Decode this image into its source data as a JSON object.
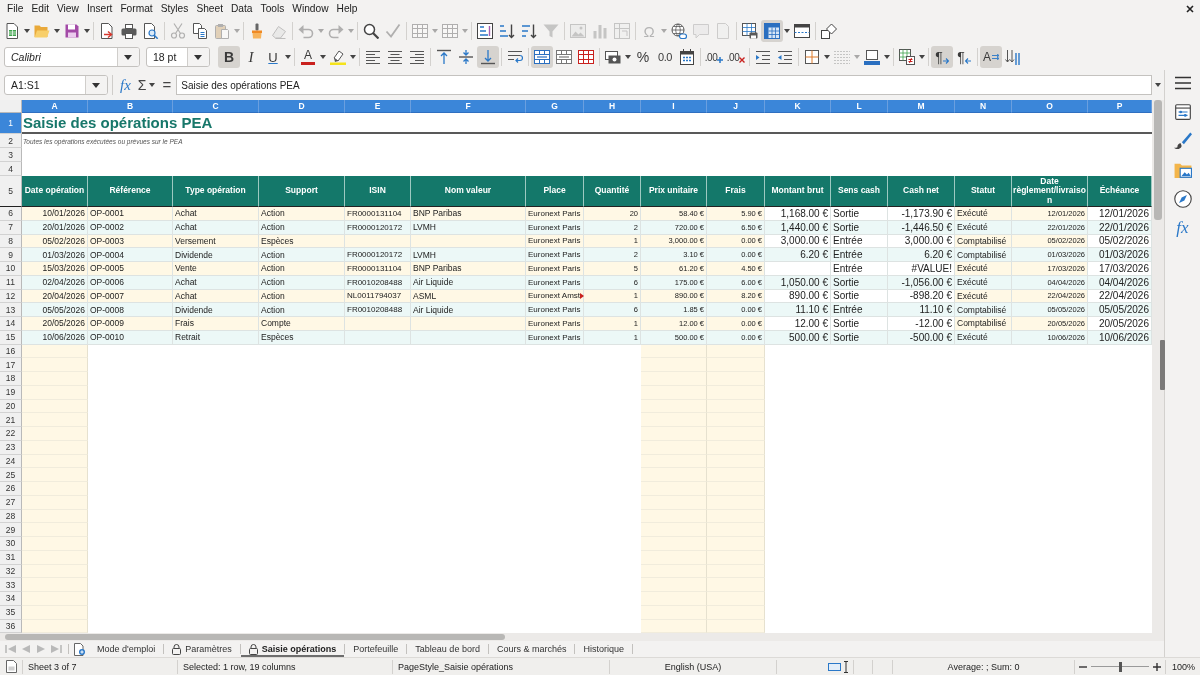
{
  "menu_bar": {
    "items": [
      "File",
      "Edit",
      "View",
      "Insert",
      "Format",
      "Styles",
      "Sheet",
      "Data",
      "Tools",
      "Window",
      "Help"
    ]
  },
  "standard_toolbar": {
    "groups": [
      [
        {
          "kind": "new",
          "on": false,
          "disabled": false
        },
        {
          "kind": "open",
          "on": false,
          "disabled": false
        },
        {
          "kind": "save",
          "on": false,
          "disabled": false
        }
      ],
      [
        {
          "kind": "pdf",
          "on": false,
          "disabled": false
        },
        {
          "kind": "print",
          "on": false,
          "disabled": false
        },
        {
          "kind": "preview",
          "on": false,
          "disabled": false
        }
      ],
      [
        {
          "kind": "cut",
          "on": false,
          "disabled": true
        },
        {
          "kind": "copy",
          "on": false,
          "disabled": false
        },
        {
          "kind": "paste",
          "on": false,
          "disabled": true
        }
      ],
      [
        {
          "kind": "clone",
          "on": false,
          "disabled": false
        },
        {
          "kind": "clear",
          "on": false,
          "disabled": true
        }
      ],
      [
        {
          "kind": "undo",
          "on": false,
          "disabled": true
        },
        {
          "kind": "redo",
          "on": false,
          "disabled": true
        }
      ],
      [
        {
          "kind": "find",
          "on": false,
          "disabled": false
        },
        {
          "kind": "spelling",
          "on": false,
          "disabled": true
        }
      ],
      [
        {
          "kind": "row",
          "on": false,
          "disabled": true
        },
        {
          "kind": "column",
          "on": false,
          "disabled": true
        }
      ],
      [
        {
          "kind": "sort",
          "on": false,
          "disabled": false
        },
        {
          "kind": "ascending",
          "on": false,
          "disabled": false
        },
        {
          "kind": "descending",
          "on": false,
          "disabled": false
        },
        {
          "kind": "autofilter",
          "on": false,
          "disabled": true
        }
      ],
      [
        {
          "kind": "image",
          "on": false,
          "disabled": true
        },
        {
          "kind": "chart",
          "on": false,
          "disabled": true
        },
        {
          "kind": "pivot",
          "on": false,
          "disabled": true
        }
      ],
      [
        {
          "kind": "special",
          "glyph": "Ω",
          "on": false,
          "disabled": true
        },
        {
          "kind": "hyperlink",
          "on": false,
          "disabled": false
        },
        {
          "kind": "comment",
          "on": false,
          "disabled": true
        },
        {
          "kind": "headerfooter",
          "on": false,
          "disabled": true
        }
      ],
      [
        {
          "kind": "printarea",
          "on": false,
          "disabled": false
        },
        {
          "kind": "freeze",
          "on": true,
          "disabled": false
        },
        {
          "kind": "split",
          "on": false,
          "disabled": false
        }
      ],
      [
        {
          "kind": "draw",
          "on": false,
          "disabled": false
        }
      ]
    ]
  },
  "formatting_toolbar": {
    "font_name": "Calibri",
    "font_size": "18 pt",
    "groups": [
      [
        {
          "kind": "bold",
          "glyph": "B",
          "on": true,
          "disabled": false
        },
        {
          "kind": "italic",
          "glyph": "I",
          "on": false,
          "disabled": false
        },
        {
          "kind": "underline",
          "glyph": "U",
          "on": false,
          "disabled": false
        }
      ],
      [
        {
          "kind": "fontcolor",
          "glyph": "A",
          "on": false,
          "disabled": false
        },
        {
          "kind": "highlight",
          "on": false,
          "disabled": false
        }
      ],
      [
        {
          "kind": "left",
          "on": false,
          "disabled": false
        },
        {
          "kind": "center",
          "on": false,
          "disabled": false
        },
        {
          "kind": "right",
          "on": false,
          "disabled": false
        }
      ],
      [
        {
          "kind": "top",
          "on": false,
          "disabled": false
        },
        {
          "kind": "middle",
          "on": false,
          "disabled": false
        },
        {
          "kind": "bottom",
          "on": true,
          "disabled": false
        }
      ],
      [
        {
          "kind": "wrap",
          "on": false,
          "disabled": false
        }
      ],
      [
        {
          "kind": "mergecenter",
          "on": true,
          "disabled": false
        },
        {
          "kind": "merge",
          "on": false,
          "disabled": false
        },
        {
          "kind": "unmerge",
          "on": false,
          "disabled": false
        }
      ],
      [
        {
          "kind": "numberformat",
          "on": false,
          "disabled": false
        },
        {
          "kind": "percent",
          "glyph": "%",
          "on": false,
          "disabled": false
        },
        {
          "kind": "number",
          "glyph": "0.0",
          "on": false,
          "disabled": false
        },
        {
          "kind": "date",
          "on": false,
          "disabled": false
        }
      ],
      [
        {
          "kind": "adddecimal",
          "glyph": ".00",
          "on": false,
          "disabled": false
        },
        {
          "kind": "deletedecimal",
          "glyph": ".00",
          "on": false,
          "disabled": false
        }
      ],
      [
        {
          "kind": "indent",
          "on": false,
          "disabled": false
        },
        {
          "kind": "outdent",
          "on": false,
          "disabled": false
        }
      ],
      [
        {
          "kind": "borders",
          "on": false,
          "disabled": false
        },
        {
          "kind": "borderstyle",
          "on": false,
          "disabled": true
        },
        {
          "kind": "bordercolor",
          "on": false,
          "disabled": false
        }
      ],
      [
        {
          "kind": "conditional",
          "on": false,
          "disabled": false
        }
      ],
      [
        {
          "kind": "ltr",
          "glyph": "¶",
          "on": true,
          "disabled": false
        },
        {
          "kind": "rtl",
          "glyph": "¶",
          "on": false,
          "disabled": false
        }
      ],
      [
        {
          "kind": "horizontal",
          "glyph": "A",
          "on": true,
          "disabled": false
        },
        {
          "kind": "vertical",
          "on": false,
          "disabled": false
        }
      ]
    ]
  },
  "formula_bar": {
    "name_box": "A1:S1",
    "function_wizard": "fx",
    "sum": "Σ",
    "formula": "=",
    "content": "Saisie des opérations PEA"
  },
  "sidebar": {
    "items": [
      {
        "kind": "properties",
        "selected": false
      },
      {
        "kind": "styles",
        "selected": false
      },
      {
        "kind": "gallery",
        "selected": false
      },
      {
        "kind": "navigator",
        "selected": false
      },
      {
        "kind": "functions",
        "glyph": "fx",
        "selected": false
      }
    ]
  },
  "sheet": {
    "column_headers": [
      {
        "label": "A",
        "selected": true
      },
      {
        "label": "B",
        "selected": true
      },
      {
        "label": "C",
        "selected": true
      },
      {
        "label": "D",
        "selected": true
      },
      {
        "label": "E",
        "selected": true
      },
      {
        "label": "F",
        "selected": true
      },
      {
        "label": "G",
        "selected": true
      },
      {
        "label": "H",
        "selected": true
      },
      {
        "label": "I",
        "selected": true
      },
      {
        "label": "J",
        "selected": true
      },
      {
        "label": "K",
        "selected": true
      },
      {
        "label": "L",
        "selected": true
      },
      {
        "label": "M",
        "selected": true
      },
      {
        "label": "N",
        "selected": true
      },
      {
        "label": "O",
        "selected": true
      },
      {
        "label": "P",
        "selected": true
      }
    ],
    "row_headers": [
      {
        "label": "1",
        "selected": true
      },
      {
        "label": "2",
        "selected": false
      },
      {
        "label": "3",
        "selected": false
      },
      {
        "label": "4",
        "selected": false
      },
      {
        "label": "5",
        "selected": false
      },
      {
        "label": "6",
        "selected": false
      },
      {
        "label": "7",
        "selected": false
      },
      {
        "label": "8",
        "selected": false
      },
      {
        "label": "9",
        "selected": false
      },
      {
        "label": "10",
        "selected": false
      },
      {
        "label": "11",
        "selected": false
      },
      {
        "label": "12",
        "selected": false
      },
      {
        "label": "13",
        "selected": false
      },
      {
        "label": "14",
        "selected": false
      },
      {
        "label": "15",
        "selected": false
      },
      {
        "label": "16",
        "selected": false
      },
      {
        "label": "17",
        "selected": false
      },
      {
        "label": "18",
        "selected": false
      },
      {
        "label": "19",
        "selected": false
      },
      {
        "label": "20",
        "selected": false
      },
      {
        "label": "21",
        "selected": false
      },
      {
        "label": "22",
        "selected": false
      },
      {
        "label": "23",
        "selected": false
      },
      {
        "label": "24",
        "selected": false
      },
      {
        "label": "25",
        "selected": false
      },
      {
        "label": "26",
        "selected": false
      },
      {
        "label": "27",
        "selected": false
      },
      {
        "label": "28",
        "selected": false
      },
      {
        "label": "29",
        "selected": false
      },
      {
        "label": "30",
        "selected": false
      },
      {
        "label": "31",
        "selected": false
      },
      {
        "label": "32",
        "selected": false
      },
      {
        "label": "33",
        "selected": false
      },
      {
        "label": "34",
        "selected": false
      },
      {
        "label": "35",
        "selected": false
      },
      {
        "label": "36",
        "selected": false
      }
    ],
    "title": "Saisie des opérations PEA",
    "subtitle": "Toutes les opérations exécutées ou prévues sur le PEA",
    "table": {
      "columns": [
        "Date opération",
        "Référence",
        "Type opération",
        "Support",
        "ISIN",
        "Nom valeur",
        "Place",
        "Quantité",
        "Prix unitaire",
        "Frais",
        "Montant brut",
        "Sens cash",
        "Cash net",
        "Statut",
        "Date règlement/livraison",
        "Échéance"
      ],
      "rows": [
        {
          "cells": {
            "A": "10/01/2026",
            "B": "OP-0001",
            "C": "Achat",
            "D": "Action",
            "E": "FR0000131104",
            "F": "BNP Paribas",
            "G": "Euronext Paris",
            "H": "20",
            "I": "58.40 €",
            "J": "5.90 €",
            "K": "1,168.00 €",
            "L": "Sortie",
            "M": "-1,173.90 €",
            "N": "Exécuté",
            "O": "12/01/2026",
            "P": "12/01/2026"
          },
          "place_overflow": false
        },
        {
          "cells": {
            "A": "20/01/2026",
            "B": "OP-0002",
            "C": "Achat",
            "D": "Action",
            "E": "FR0000120172",
            "F": "LVMH",
            "G": "Euronext Paris",
            "H": "2",
            "I": "720.00 €",
            "J": "6.50 €",
            "K": "1,440.00 €",
            "L": "Sortie",
            "M": "-1,446.50 €",
            "N": "Exécuté",
            "O": "22/01/2026",
            "P": "22/01/2026"
          },
          "place_overflow": false
        },
        {
          "cells": {
            "A": "05/02/2026",
            "B": "OP-0003",
            "C": "Versement",
            "D": "Espèces",
            "G": "Euronext Paris",
            "H": "1",
            "I": "3,000.00 €",
            "J": "0.00 €",
            "K": "3,000.00 €",
            "L": "Entrée",
            "M": "3,000.00 €",
            "N": "Comptabilisé",
            "O": "05/02/2026",
            "P": "05/02/2026"
          },
          "place_overflow": false
        },
        {
          "cells": {
            "A": "01/03/2026",
            "B": "OP-0004",
            "C": "Dividende",
            "D": "Action",
            "E": "FR0000120172",
            "F": "LVMH",
            "G": "Euronext Paris",
            "H": "2",
            "I": "3.10 €",
            "J": "0.00 €",
            "K": "6.20 €",
            "L": "Entrée",
            "M": "6.20 €",
            "N": "Comptabilisé",
            "O": "01/03/2026",
            "P": "01/03/2026"
          },
          "place_overflow": false
        },
        {
          "cells": {
            "A": "15/03/2026",
            "B": "OP-0005",
            "C": "Vente",
            "D": "Action",
            "E": "FR0000131104",
            "F": "BNP Paribas",
            "G": "Euronext Paris",
            "H": "5",
            "I": "61.20 €",
            "J": "4.50 €",
            "L": "Entrée",
            "M": "#VALUE!",
            "N": "Exécuté",
            "O": "17/03/2026",
            "P": "17/03/2026"
          },
          "place_overflow": false
        },
        {
          "cells": {
            "A": "02/04/2026",
            "B": "OP-0006",
            "C": "Achat",
            "D": "Action",
            "E": "FR0010208488",
            "F": "Air Liquide",
            "G": "Euronext Paris",
            "H": "6",
            "I": "175.00 €",
            "J": "6.00 €",
            "K": "1,050.00 €",
            "L": "Sortie",
            "M": "-1,056.00 €",
            "N": "Exécuté",
            "O": "04/04/2026",
            "P": "04/04/2026"
          },
          "place_overflow": false
        },
        {
          "cells": {
            "A": "20/04/2026",
            "B": "OP-0007",
            "C": "Achat",
            "D": "Action",
            "E": "NL0011794037",
            "F": "ASML",
            "G": "Euronext Amst",
            "H": "1",
            "I": "890.00 €",
            "J": "8.20 €",
            "K": "890.00 €",
            "L": "Sortie",
            "M": "-898.20 €",
            "N": "Exécuté",
            "O": "22/04/2026",
            "P": "22/04/2026"
          },
          "place_overflow": true
        },
        {
          "cells": {
            "A": "05/05/2026",
            "B": "OP-0008",
            "C": "Dividende",
            "D": "Action",
            "E": "FR0010208488",
            "F": "Air Liquide",
            "G": "Euronext Paris",
            "H": "6",
            "I": "1.85 €",
            "J": "0.00 €",
            "K": "11.10 €",
            "L": "Entrée",
            "M": "11.10 €",
            "N": "Comptabilisé",
            "O": "05/05/2026",
            "P": "05/05/2026"
          },
          "place_overflow": false
        },
        {
          "cells": {
            "A": "20/05/2026",
            "B": "OP-0009",
            "C": "Frais",
            "D": "Compte",
            "G": "Euronext Paris",
            "H": "1",
            "I": "12.00 €",
            "J": "0.00 €",
            "K": "12.00 €",
            "L": "Sortie",
            "M": "-12.00 €",
            "N": "Comptabilisé",
            "O": "20/05/2026",
            "P": "20/05/2026"
          },
          "place_overflow": false
        },
        {
          "cells": {
            "A": "10/06/2026",
            "B": "OP-0010",
            "C": "Retrait",
            "D": "Espèces",
            "G": "Euronext Paris",
            "H": "1",
            "I": "500.00 €",
            "J": "0.00 €",
            "K": "500.00 €",
            "L": "Sortie",
            "M": "-500.00 €",
            "N": "Exécuté",
            "O": "10/06/2026",
            "P": "10/06/2026"
          },
          "place_overflow": false
        }
      ]
    }
  },
  "sheet_tabs": [
    {
      "label": "Mode d'emploi",
      "locked": false,
      "selected": false
    },
    {
      "label": "Paramètres",
      "locked": true,
      "selected": false
    },
    {
      "label": "Saisie opérations",
      "locked": true,
      "selected": true
    },
    {
      "label": "Portefeuille",
      "locked": false,
      "selected": false
    },
    {
      "label": "Tableau de bord",
      "locked": false,
      "selected": false
    },
    {
      "label": "Cours & marchés",
      "locked": false,
      "selected": false
    },
    {
      "label": "Historique",
      "locked": false,
      "selected": false
    }
  ],
  "status_bar": {
    "sheet": "Sheet 3 of 7",
    "selection": "Selected: 1 row, 19 columns",
    "page_style": "PageStyle_Saisie opérations",
    "language": "English (USA)",
    "summary": "Average: ; Sum: 0",
    "zoom": {
      "level": 0.5,
      "label": "100%"
    }
  }
}
